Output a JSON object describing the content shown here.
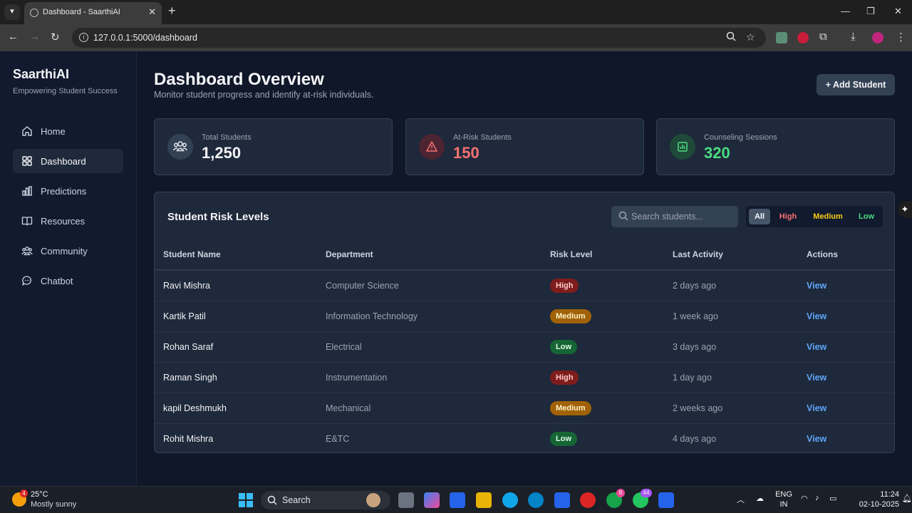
{
  "browser": {
    "tab_title": "Dashboard - SaarthiAI",
    "url": "127.0.0.1:5000/dashboard"
  },
  "sidebar": {
    "brand": "SaarthiAI",
    "tagline": "Empowering Student Success",
    "items": [
      {
        "label": "Home",
        "icon": "home-icon"
      },
      {
        "label": "Dashboard",
        "icon": "grid-icon",
        "active": true
      },
      {
        "label": "Predictions",
        "icon": "bar-chart-icon"
      },
      {
        "label": "Resources",
        "icon": "book-icon"
      },
      {
        "label": "Community",
        "icon": "users-icon"
      },
      {
        "label": "Chatbot",
        "icon": "chat-icon"
      }
    ]
  },
  "header": {
    "title": "Dashboard Overview",
    "subtitle": "Monitor student progress and identify at-risk individuals.",
    "add_button": "+ Add Student"
  },
  "stats": [
    {
      "label": "Total Students",
      "value": "1,250",
      "color": "#f3f4f6",
      "icon": "users-icon"
    },
    {
      "label": "At-Risk Students",
      "value": "150",
      "color": "#f87171",
      "icon": "warning-icon"
    },
    {
      "label": "Counseling Sessions",
      "value": "320",
      "color": "#4ade80",
      "icon": "chart-icon"
    }
  ],
  "table": {
    "title": "Student Risk Levels",
    "search_placeholder": "Search students...",
    "filters": [
      "All",
      "High",
      "Medium",
      "Low"
    ],
    "columns": [
      "Student Name",
      "Department",
      "Risk Level",
      "Last Activity",
      "Actions"
    ],
    "rows": [
      {
        "name": "Ravi Mishra",
        "department": "Computer Science",
        "risk": "High",
        "activity": "2 days ago",
        "action": "View"
      },
      {
        "name": "Kartik Patil",
        "department": "Information Technology",
        "risk": "Medium",
        "activity": "1 week ago",
        "action": "View"
      },
      {
        "name": "Rohan Saraf",
        "department": "Electrical",
        "risk": "Low",
        "activity": "3 days ago",
        "action": "View"
      },
      {
        "name": "Raman Singh",
        "department": "Instrumentation",
        "risk": "High",
        "activity": "1 day ago",
        "action": "View"
      },
      {
        "name": "kapil Deshmukh",
        "department": "Mechanical",
        "risk": "Medium",
        "activity": "2 weeks ago",
        "action": "View"
      },
      {
        "name": "Rohit Mishra",
        "department": "E&TC",
        "risk": "Low",
        "activity": "4 days ago",
        "action": "View"
      }
    ]
  },
  "taskbar": {
    "weather_badge": "4",
    "temperature": "25°C",
    "condition": "Mostly sunny",
    "search_label": "Search",
    "chrome_badge": "8",
    "whatsapp_badge": "44",
    "lang_line1": "ENG",
    "lang_line2": "IN",
    "time": "11:24",
    "date": "02-10-2025"
  },
  "colors": {
    "accent_link": "#60a5fa",
    "high": "#7f1d1d",
    "medium": "#a16207",
    "low": "#166534"
  }
}
